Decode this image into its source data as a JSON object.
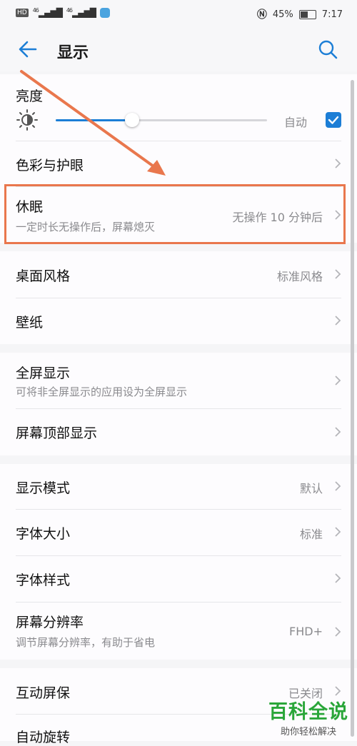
{
  "status_bar": {
    "hd": "HD",
    "net1": "46",
    "net2": "46",
    "battery": "45%",
    "time": "7:17"
  },
  "header": {
    "title": "显示"
  },
  "brightness": {
    "label": "亮度",
    "auto_label": "自动",
    "level": 0.36,
    "auto_checked": true
  },
  "rows": {
    "color": {
      "label": "色彩与护眼"
    },
    "sleep": {
      "label": "休眠",
      "subtitle": "一定时长无操作后，屏幕熄灭",
      "value": "无操作 10 分钟后"
    },
    "desktop": {
      "label": "桌面风格",
      "value": "标准风格"
    },
    "wallpaper": {
      "label": "壁纸"
    },
    "fullscreen": {
      "label": "全屏显示",
      "subtitle": "可将非全屏显示的应用设为全屏显示"
    },
    "notch": {
      "label": "屏幕顶部显示"
    },
    "mode": {
      "label": "显示模式",
      "value": "默认"
    },
    "fontsize": {
      "label": "字体大小",
      "value": "标准"
    },
    "fontstyle": {
      "label": "字体样式"
    },
    "resolution": {
      "label": "屏幕分辨率",
      "subtitle": "调节屏幕分辨率，有助于省电",
      "value": "FHD+"
    },
    "screensaver": {
      "label": "互动屏保",
      "value": "已关闭"
    },
    "rotate": {
      "label": "自动旋转"
    }
  },
  "watermark": {
    "brand": "百科全说",
    "tagline": "助你轻松解决"
  },
  "colors": {
    "accent": "#1c7ed6",
    "annotation": "#e9774d",
    "watermark": "#2aa639"
  }
}
